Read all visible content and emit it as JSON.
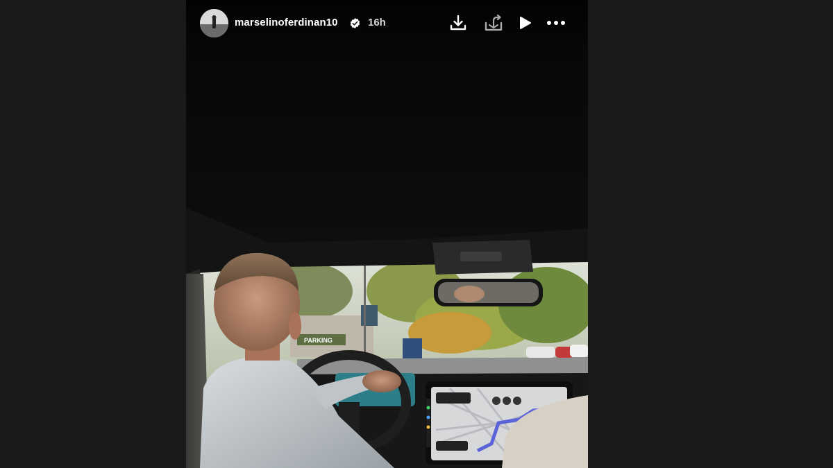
{
  "story": {
    "username": "marselinoferdinan10",
    "verified": true,
    "timestamp": "16h",
    "photo": {
      "description_icon": "car-interior-photo",
      "sign_text": "PARKING"
    }
  },
  "controls": {
    "download_icon": "download-icon",
    "share_icon": "share-tray-icon",
    "play_icon": "play-icon",
    "more_icon": "more-options-icon"
  },
  "colors": {
    "page_background": "#1a1a1a",
    "story_background": "#050505",
    "text": "#ffffff",
    "muted_text": "#d8d8d8"
  }
}
